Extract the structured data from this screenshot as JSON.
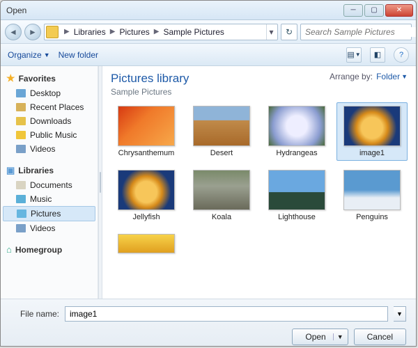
{
  "window": {
    "title": "Open"
  },
  "breadcrumbs": {
    "root": "Libraries",
    "mid": "Pictures",
    "leaf": "Sample Pictures"
  },
  "search": {
    "placeholder": "Search Sample Pictures"
  },
  "toolbar": {
    "organize": "Organize",
    "newfolder": "New folder"
  },
  "sidebar": {
    "favorites": "Favorites",
    "items_fav": [
      {
        "label": "Desktop",
        "color": "#6aa6d6"
      },
      {
        "label": "Recent Places",
        "color": "#d7b25a"
      },
      {
        "label": "Downloads",
        "color": "#e6c24a"
      },
      {
        "label": "Public Music",
        "color": "#f0c63a"
      },
      {
        "label": "Videos",
        "color": "#7aa0c8"
      }
    ],
    "libraries": "Libraries",
    "items_lib": [
      {
        "label": "Documents",
        "color": "#d9d4c2"
      },
      {
        "label": "Music",
        "color": "#5bb0d8"
      },
      {
        "label": "Pictures",
        "color": "#66b6e0",
        "selected": true
      },
      {
        "label": "Videos",
        "color": "#7aa0c8"
      }
    ],
    "homegroup": "Homegroup"
  },
  "main": {
    "title": "Pictures library",
    "subtitle": "Sample Pictures",
    "arrange_label": "Arrange by:",
    "arrange_value": "Folder"
  },
  "thumbs": [
    {
      "label": "Chrysanthemum",
      "bg": "linear-gradient(135deg,#d73a12,#f07a2a 40%,#f7a84a)"
    },
    {
      "label": "Desert",
      "bg": "linear-gradient(#8fb4d8 35%,#c08a4a 36%,#a86a2a)"
    },
    {
      "label": "Hydrangeas",
      "bg": "radial-gradient(circle,#eef 30%,#8a9cd0 70%,#4a6a3a)"
    },
    {
      "label": "image1",
      "bg": "radial-gradient(circle at 50% 55%,#f7c65a 30%,#d68a1a 45%,#1a3a7a 70%)",
      "selected": true
    },
    {
      "label": "Jellyfish",
      "bg": "radial-gradient(circle at 50% 55%,#f7c65a 30%,#d68a1a 45%,#1a3a7a 70%)"
    },
    {
      "label": "Koala",
      "bg": "linear-gradient(#7a8a6a,#9aa090 40%,#6a6a5a)"
    },
    {
      "label": "Lighthouse",
      "bg": "linear-gradient(#6aa8e0 55%,#2a4a3a 56%)"
    },
    {
      "label": "Penguins",
      "bg": "linear-gradient(#5a9ad0 50%,#e8eef5 70%)"
    }
  ],
  "footer": {
    "filename_label": "File name:",
    "filename_value": "image1",
    "open": "Open",
    "cancel": "Cancel"
  }
}
